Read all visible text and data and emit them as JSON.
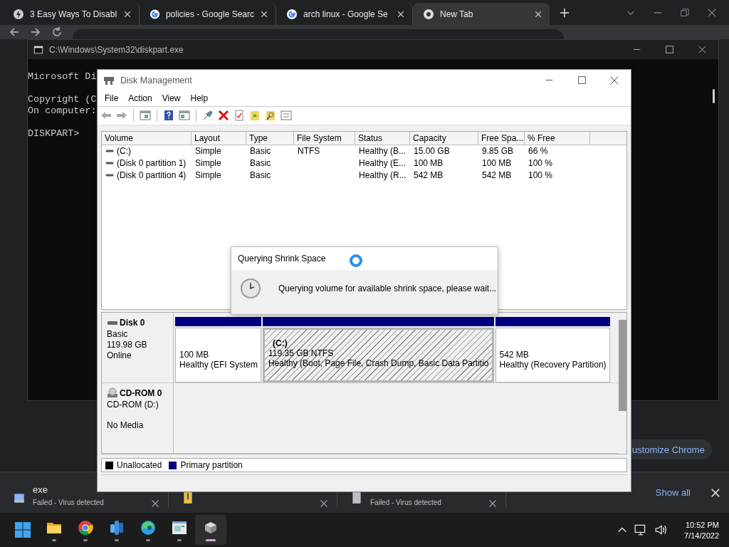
{
  "browser": {
    "tabs": [
      {
        "title": "3 Easy Ways To Disabl",
        "kind": "bolt",
        "selected": false
      },
      {
        "title": "policies - Google Searc",
        "kind": "google",
        "selected": false
      },
      {
        "title": "arch linux - Google Se",
        "kind": "google",
        "selected": false
      },
      {
        "title": "New Tab",
        "kind": "chrome",
        "selected": true
      }
    ],
    "customize_button": "ustomize Chrome"
  },
  "console": {
    "title": "C:\\Windows\\System32\\diskpart.exe",
    "paragraphs": [
      [
        "Microsoft Di"
      ],
      [
        "Copyright (C",
        "On computer:"
      ],
      [
        "DISKPART>"
      ]
    ]
  },
  "disk_management": {
    "title": "Disk Management",
    "menu": [
      "File",
      "Action",
      "View",
      "Help"
    ],
    "columns": [
      "Volume",
      "Layout",
      "Type",
      "File System",
      "Status",
      "Capacity",
      "Free Spa...",
      "% Free"
    ],
    "rows": [
      {
        "cells": [
          "(C:)",
          "Simple",
          "Basic",
          "NTFS",
          "Healthy (B...",
          "15.00 GB",
          "9.85 GB",
          "66 %"
        ]
      },
      {
        "cells": [
          "(Disk 0 partition 1)",
          "Simple",
          "Basic",
          "",
          "Healthy (E...",
          "100 MB",
          "100 MB",
          "100 %"
        ]
      },
      {
        "cells": [
          "(Disk 0 partition 4)",
          "Simple",
          "Basic",
          "",
          "Healthy (R...",
          "542 MB",
          "542 MB",
          "100 %"
        ]
      }
    ],
    "disks": [
      {
        "name": "Disk 0",
        "kind": "disk",
        "details": [
          "Basic",
          "119.98 GB",
          "Online"
        ],
        "partitions": [
          {
            "lines": [
              "100 MB",
              "Healthy (EFI System"
            ],
            "selected": false
          },
          {
            "lines": [
              "(C:)",
              "119.35 GB NTFS",
              "Healthy (Boot, Page File, Crash Dump, Basic Data Partitio"
            ],
            "selected": true
          },
          {
            "lines": [
              "542 MB",
              "Healthy (Recovery Partition)"
            ],
            "selected": false
          }
        ]
      },
      {
        "name": "CD-ROM 0",
        "kind": "cdrom",
        "details": [
          "CD-ROM (D:)",
          "No Media"
        ]
      }
    ],
    "legend": [
      {
        "label": "Unallocated",
        "color": "#000000"
      },
      {
        "label": "Primary partition",
        "color": "#000080"
      }
    ]
  },
  "dialog": {
    "title": "Querying Shrink Space",
    "message": "Querying volume for available shrink space, please wait..."
  },
  "downloads": {
    "items": [
      {
        "kind": "app",
        "name": "exe",
        "status": "Failed - Virus detected"
      },
      {
        "kind": "zip"
      },
      {
        "kind": "file",
        "status": "Failed - Virus detected"
      }
    ],
    "show_all": "Show all"
  },
  "taskbar": {
    "apps": [
      {
        "kind": "start",
        "active": false
      },
      {
        "kind": "folder",
        "active": false
      },
      {
        "kind": "chrome",
        "active": false
      },
      {
        "kind": "app",
        "active": false
      },
      {
        "kind": "edge",
        "active": false
      },
      {
        "kind": "window",
        "active": false
      },
      {
        "kind": "disk",
        "active": true
      }
    ],
    "time": "10:52 PM",
    "date": "7/14/2022"
  }
}
